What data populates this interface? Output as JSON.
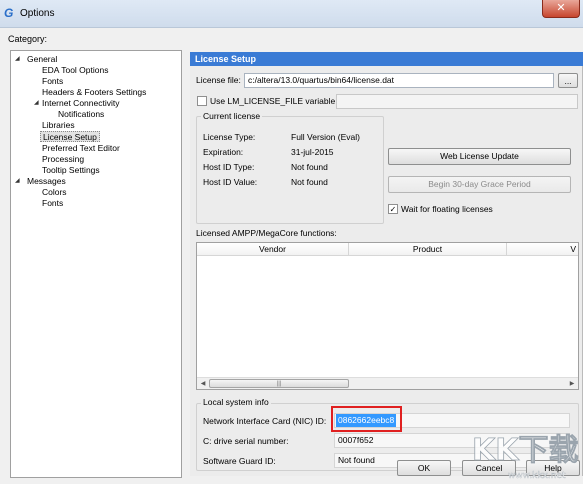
{
  "window": {
    "title": "Options",
    "close_glyph": "✕"
  },
  "category_label": "Category:",
  "tree": [
    {
      "label": "General",
      "expander": "◢"
    },
    {
      "label": "EDA Tool Options"
    },
    {
      "label": "Fonts"
    },
    {
      "label": "Headers & Footers Settings"
    },
    {
      "label": "Internet Connectivity",
      "expander": "◢"
    },
    {
      "label": "Notifications"
    },
    {
      "label": "Libraries"
    },
    {
      "label": "License Setup",
      "selected": true
    },
    {
      "label": "Preferred Text Editor"
    },
    {
      "label": "Processing"
    },
    {
      "label": "Tooltip Settings"
    },
    {
      "label": "Messages",
      "expander": "◢"
    },
    {
      "label": "Colors"
    },
    {
      "label": "Fonts"
    }
  ],
  "license": {
    "header": "License Setup",
    "license_file_label": "License file:",
    "license_file_value": "c:/altera/13.0/quartus/bin64/license.dat",
    "browse_label": "...",
    "use_env_label": "Use LM_LICENSE_FILE variable:",
    "current_license_title": "Current license",
    "rows": [
      {
        "label": "License Type:",
        "value": "Full Version (Eval)"
      },
      {
        "label": "Expiration:",
        "value": "31-jul-2015"
      },
      {
        "label": "Host ID Type:",
        "value": "Not found"
      },
      {
        "label": "Host ID Value:",
        "value": "Not found"
      }
    ],
    "web_update_label": "Web License Update",
    "grace_label": "Begin 30-day Grace Period",
    "wait_floating_label": "Wait for floating licenses",
    "wait_floating_checked": true,
    "licensed_functions_label": "Licensed AMPP/MegaCore functions:",
    "columns": [
      "Vendor",
      "Product",
      "V"
    ],
    "local_info_title": "Local system info",
    "nic_label": "Network Interface Card (NIC) ID:",
    "nic_value": "0862662eebc8",
    "serial_label": "C: drive serial number:",
    "serial_value": "0007f652",
    "guard_label": "Software Guard ID:",
    "guard_value": "Not found"
  },
  "buttons": {
    "ok": "OK",
    "cancel": "Cancel",
    "help": "Help"
  },
  "watermark": {
    "brand": "KK下载",
    "url": "www.kkx.net"
  },
  "colors": {
    "accent": "#3a7bd5",
    "highlight_box": "#e02020",
    "selection": "#3399ff"
  }
}
